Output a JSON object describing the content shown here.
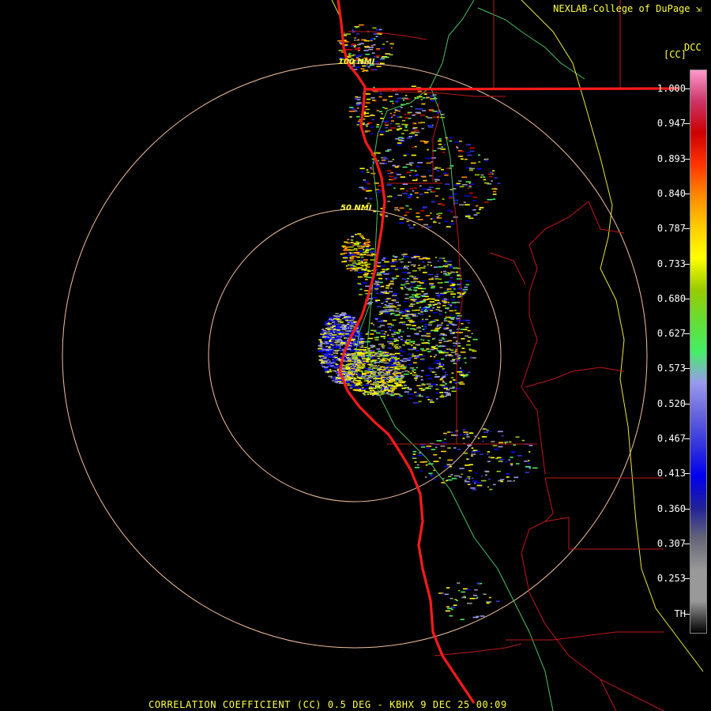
{
  "header": {
    "credit": "NEXLAB-College of DuPage",
    "product_code": "DCC",
    "unit": "[CC]"
  },
  "footer": {
    "text": "CORRELATION COEFFICIENT (CC) 0.5 DEG - KBHX 9 DEC 25 00:09"
  },
  "map": {
    "range_rings": [
      {
        "label": "100 NMI"
      },
      {
        "label": "50 NMI"
      }
    ],
    "colors": {
      "coastline": "#ff1a1a",
      "county_lines": "#c01818",
      "state_line": "#e8e840",
      "highways": "#4cc060",
      "rings": "#f0c0a0"
    }
  },
  "legend": {
    "ticks": [
      "1.000",
      "0.947",
      "0.893",
      "0.840",
      "0.787",
      "0.733",
      "0.680",
      "0.627",
      "0.573",
      "0.520",
      "0.467",
      "0.413",
      "0.360",
      "0.307",
      "0.253",
      "TH"
    ],
    "gradient": [
      {
        "value": 1.0,
        "color": "#ff99cc"
      },
      {
        "value": 0.98,
        "color": "#cc3366"
      },
      {
        "value": 0.96,
        "color": "#cc0000"
      },
      {
        "value": 0.945,
        "color": "#ff3300"
      },
      {
        "value": 0.925,
        "color": "#ff8800"
      },
      {
        "value": 0.9,
        "color": "#ffcc00"
      },
      {
        "value": 0.87,
        "color": "#ffff00"
      },
      {
        "value": 0.84,
        "color": "#99cc00"
      },
      {
        "value": 0.81,
        "color": "#66dd33"
      },
      {
        "value": 0.78,
        "color": "#44ee66"
      },
      {
        "value": 0.755,
        "color": "#9999ee"
      },
      {
        "value": 0.735,
        "color": "#6666dd"
      },
      {
        "value": 0.715,
        "color": "#3333dd"
      },
      {
        "value": 0.6,
        "color": "#0000ee"
      },
      {
        "value": 0.44,
        "color": "#222299"
      },
      {
        "value": 0.42,
        "color": "#666677"
      },
      {
        "value": 0.4,
        "color": "#999999"
      },
      {
        "value": 0.23,
        "color": "#999999"
      },
      {
        "value": 0.21,
        "color": "#000000"
      }
    ]
  }
}
